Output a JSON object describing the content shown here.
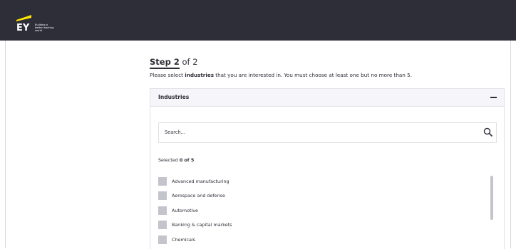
{
  "header": {
    "logo_text": "EY",
    "tagline": "Building a better working world",
    "brand_color": "#2e2e38",
    "accent_color": "#ffe600"
  },
  "step": {
    "label": "Step 2",
    "of": "of 2"
  },
  "instruction": {
    "prefix": "Please select ",
    "bold": "industries",
    "suffix": " that you are interested in. You must choose at least one but no more than 5."
  },
  "panel": {
    "title": "Industries",
    "collapse_icon": "minus-icon",
    "search": {
      "placeholder": "Search...",
      "icon": "search-icon"
    },
    "selected": {
      "prefix": "Selected ",
      "count": "0 of 5"
    },
    "items": [
      {
        "label": "Advanced manufacturing",
        "checked": false
      },
      {
        "label": "Aerospace and defense",
        "checked": false
      },
      {
        "label": "Automotive",
        "checked": false
      },
      {
        "label": "Banking & capital markets",
        "checked": false
      },
      {
        "label": "Chemicals",
        "checked": false
      }
    ]
  }
}
